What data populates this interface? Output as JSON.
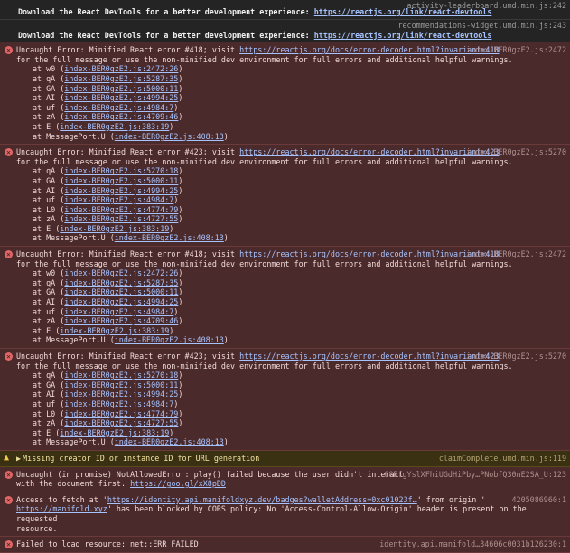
{
  "info": [
    {
      "src": "activity-leaderboard.umd.min.js:242",
      "msg": "Download the React DevTools for a better development experience: ",
      "link": "https://reactjs.org/link/react-devtools"
    },
    {
      "src": "recommendations-widget.umd.min.js:243",
      "msg": "Download the React DevTools for a better development experience: ",
      "link": "https://reactjs.org/link/react-devtools"
    }
  ],
  "errors": [
    {
      "pre": "Uncaught Error: Minified React error #418; visit ",
      "link": "https://reactjs.org/docs/error-decoder.html?invariant=418",
      "src": "index-BER0gzE2.js:2472",
      "line2": "for the full message or use the non-minified dev environment for full errors and additional helpful warnings.",
      "stack": [
        [
          "at w0 (",
          "index-BER0gzE2.js:2472:26",
          ")"
        ],
        [
          "at qA (",
          "index-BER0gzE2.js:5287:35",
          ")"
        ],
        [
          "at GA (",
          "index-BER0gzE2.js:5000:11",
          ")"
        ],
        [
          "at AI (",
          "index-BER0gzE2.js:4994:25",
          ")"
        ],
        [
          "at uf (",
          "index-BER0gzE2.js:4984:7",
          ")"
        ],
        [
          "at zA (",
          "index-BER0gzE2.js:4709:46",
          ")"
        ],
        [
          "at E (",
          "index-BER0gzE2.js:383:19",
          ")"
        ],
        [
          "at MessagePort.U (",
          "index-BER0gzE2.js:408:13",
          ")"
        ]
      ]
    },
    {
      "pre": "Uncaught Error: Minified React error #423; visit ",
      "link": "https://reactjs.org/docs/error-decoder.html?invariant=423",
      "src": "index-BER0gzE2.js:5270",
      "line2": "for the full message or use the non-minified dev environment for full errors and additional helpful warnings.",
      "stack": [
        [
          "at qA (",
          "index-BER0gzE2.js:5270:18",
          ")"
        ],
        [
          "at GA (",
          "index-BER0gzE2.js:5000:11",
          ")"
        ],
        [
          "at AI (",
          "index-BER0gzE2.js:4994:25",
          ")"
        ],
        [
          "at uf (",
          "index-BER0gzE2.js:4984:7",
          ")"
        ],
        [
          "at L0 (",
          "index-BER0gzE2.js:4774:79",
          ")"
        ],
        [
          "at zA (",
          "index-BER0gzE2.js:4727:55",
          ")"
        ],
        [
          "at E (",
          "index-BER0gzE2.js:383:19",
          ")"
        ],
        [
          "at MessagePort.U (",
          "index-BER0gzE2.js:408:13",
          ")"
        ]
      ]
    },
    {
      "pre": "Uncaught Error: Minified React error #418; visit ",
      "link": "https://reactjs.org/docs/error-decoder.html?invariant=418",
      "src": "index-BER0gzE2.js:2472",
      "line2": "for the full message or use the non-minified dev environment for full errors and additional helpful warnings.",
      "stack": [
        [
          "at w0 (",
          "index-BER0gzE2.js:2472:26",
          ")"
        ],
        [
          "at qA (",
          "index-BER0gzE2.js:5287:35",
          ")"
        ],
        [
          "at GA (",
          "index-BER0gzE2.js:5000:11",
          ")"
        ],
        [
          "at AI (",
          "index-BER0gzE2.js:4994:25",
          ")"
        ],
        [
          "at uf (",
          "index-BER0gzE2.js:4984:7",
          ")"
        ],
        [
          "at zA (",
          "index-BER0gzE2.js:4709:46",
          ")"
        ],
        [
          "at E (",
          "index-BER0gzE2.js:383:19",
          ")"
        ],
        [
          "at MessagePort.U (",
          "index-BER0gzE2.js:408:13",
          ")"
        ]
      ]
    },
    {
      "pre": "Uncaught Error: Minified React error #423; visit ",
      "link": "https://reactjs.org/docs/error-decoder.html?invariant=423",
      "src": "index-BER0gzE2.js:5270",
      "line2": "for the full message or use the non-minified dev environment for full errors and additional helpful warnings.",
      "stack": [
        [
          "at qA (",
          "index-BER0gzE2.js:5270:18",
          ")"
        ],
        [
          "at GA (",
          "index-BER0gzE2.js:5000:11",
          ")"
        ],
        [
          "at AI (",
          "index-BER0gzE2.js:4994:25",
          ")"
        ],
        [
          "at uf (",
          "index-BER0gzE2.js:4984:7",
          ")"
        ],
        [
          "at L0 (",
          "index-BER0gzE2.js:4774:79",
          ")"
        ],
        [
          "at zA (",
          "index-BER0gzE2.js:4727:55",
          ")"
        ],
        [
          "at E (",
          "index-BER0gzE2.js:383:19",
          ")"
        ],
        [
          "at MessagePort.U (",
          "index-BER0gzE2.js:408:13",
          ")"
        ]
      ]
    }
  ],
  "warning": {
    "msg": "Missing creator ID or instance ID for URL generation",
    "src": "claimComplete.umd.min.js:119"
  },
  "promise_error": {
    "line1": "Uncaught (in promise) NotAllowedError: play() failed because the user didn't interact",
    "src": "68EfgYslXFhiUGdHiPby…PNobfQ30nE2SA_U:123",
    "line2_pre": "with the document first. ",
    "line2_link": "https://goo.gl/xX8pDD"
  },
  "cors_error": {
    "line1_pre": "Access to fetch at '",
    "line1_link": "https://identity.api.manifoldxyz.dev/badges?walletAddress=0xc01023f…",
    "line1_post": "' from origin '",
    "src": "4205086960:1",
    "line2_link": "https://manifold.xyz",
    "line2_post": "' has been blocked by CORS policy: No 'Access-Control-Allow-Origin' header is present on the requested",
    "line3": "resource."
  },
  "cut_row": {
    "text": "Failed to load resource: net::ERR_FAILED",
    "src": "identity.api.manifold…34606c0031b126230:1"
  }
}
